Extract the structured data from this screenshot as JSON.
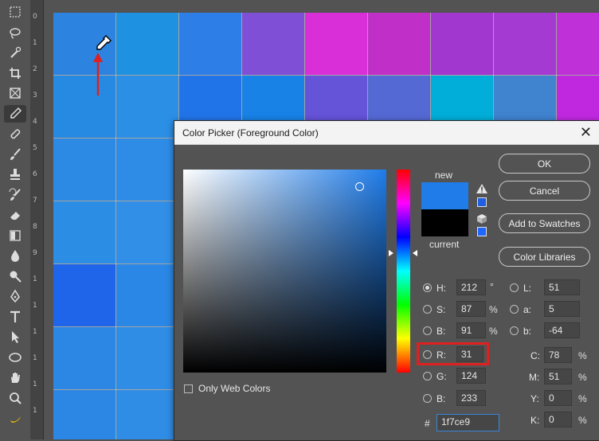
{
  "toolbar": {
    "tools": [
      "marquee-icon",
      "lasso-icon",
      "quick-select-icon",
      "crop-icon",
      "frame-icon",
      "eyedropper-icon",
      "healing-brush-icon",
      "brush-icon",
      "clone-stamp-icon",
      "history-brush-icon",
      "eraser-icon",
      "gradient-icon",
      "blur-icon",
      "dodge-icon",
      "pen-icon",
      "type-icon",
      "path-select-icon",
      "ellipse-icon",
      "hand-icon",
      "zoom-icon",
      "banana-icon"
    ]
  },
  "ruler": {
    "ticks": [
      "0",
      "1",
      "2",
      "3",
      "4",
      "5",
      "6",
      "7",
      "8",
      "9",
      "1",
      "1",
      "1",
      "1",
      "1",
      "1"
    ]
  },
  "canvas": {
    "colors": [
      [
        "#2c83e0",
        "#1e91e0",
        "#2e7ee8",
        "#7f4fd6",
        "#d92fd8",
        "#c030c8",
        "#a237d0",
        "#a43ad2",
        "#c030d8"
      ],
      [
        "#278ae2",
        "#2b8fe6",
        "#2174e8",
        "#1882e6",
        "#6553d8",
        "#5469d4",
        "#00aed9",
        "#4083cf",
        "#c028e0"
      ],
      [
        "#2d8ae4",
        "#2f8ce6"
      ],
      [
        "#2b8de4",
        "#318fe7"
      ],
      [
        "#1f65ea",
        "#2a87e6"
      ],
      [
        "#2b86e4",
        "#2f8de6"
      ],
      [
        "#2b86e4",
        "#2f8de6"
      ]
    ]
  },
  "dialog": {
    "title": "Color Picker (Foreground Color)",
    "close": "✕",
    "new_label": "new",
    "current_label": "current",
    "new_color": "#1f7ce9",
    "current_color": "#000000",
    "buttons": {
      "ok": "OK",
      "cancel": "Cancel",
      "add_swatches": "Add to Swatches",
      "color_libraries": "Color Libraries"
    },
    "only_web_colors": "Only Web Colors",
    "hsb": [
      {
        "label": "H:",
        "value": "212",
        "unit": "°"
      },
      {
        "label": "S:",
        "value": "87",
        "unit": "%"
      },
      {
        "label": "B:",
        "value": "91",
        "unit": "%"
      }
    ],
    "rgb": [
      {
        "label": "R:",
        "value": "31"
      },
      {
        "label": "G:",
        "value": "124"
      },
      {
        "label": "B:",
        "value": "233"
      }
    ],
    "lab": [
      {
        "label": "L:",
        "value": "51"
      },
      {
        "label": "a:",
        "value": "5"
      },
      {
        "label": "b:",
        "value": "-64"
      }
    ],
    "cmyk": [
      {
        "label": "C:",
        "value": "78",
        "unit": "%"
      },
      {
        "label": "M:",
        "value": "51",
        "unit": "%"
      },
      {
        "label": "Y:",
        "value": "0",
        "unit": "%"
      },
      {
        "label": "K:",
        "value": "0",
        "unit": "%"
      }
    ],
    "hex_label": "#",
    "hex": "1f7ce9"
  },
  "colors": {
    "highlight": "#e02020",
    "arrow": "#e02020"
  }
}
